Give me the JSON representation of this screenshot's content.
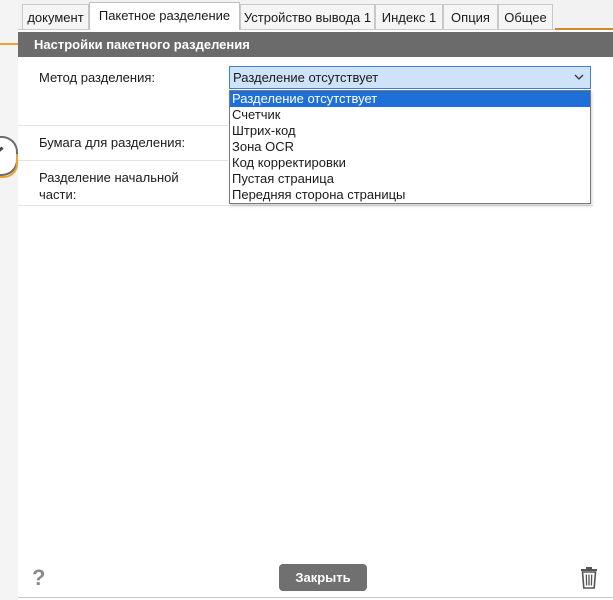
{
  "tabs": [
    {
      "label": "документ"
    },
    {
      "label": "Пакетное разделение",
      "active": true
    },
    {
      "label": "Устройство вывода 1"
    },
    {
      "label": "Индекс 1"
    },
    {
      "label": "Опция"
    },
    {
      "label": "Общее"
    }
  ],
  "section": {
    "title": "Настройки пакетного разделения"
  },
  "fields": {
    "method_label": "Метод разделения:",
    "paper_label": "Бумага для разделения:",
    "front_label": "Разделение начальной части:"
  },
  "method_select": {
    "value": "Разделение отсутствует",
    "options": [
      "Разделение отсутствует",
      "Счетчик",
      "Штрих-код",
      "Зона OCR",
      "Код корректировки",
      "Пустая страница",
      "Передняя сторона страницы"
    ],
    "selected_index": 0
  },
  "footer": {
    "help_glyph": "?",
    "close_label": "Закрыть"
  },
  "icons": {
    "help": "help-icon",
    "trash": "trash-icon",
    "chevron": "chevron-down-icon"
  },
  "colors": {
    "section_header_bg": "#6b6b6b",
    "selected_option_bg": "#1f6fd8",
    "select_bg": "#cfe3f8",
    "accent_orange": "#f0a030"
  }
}
